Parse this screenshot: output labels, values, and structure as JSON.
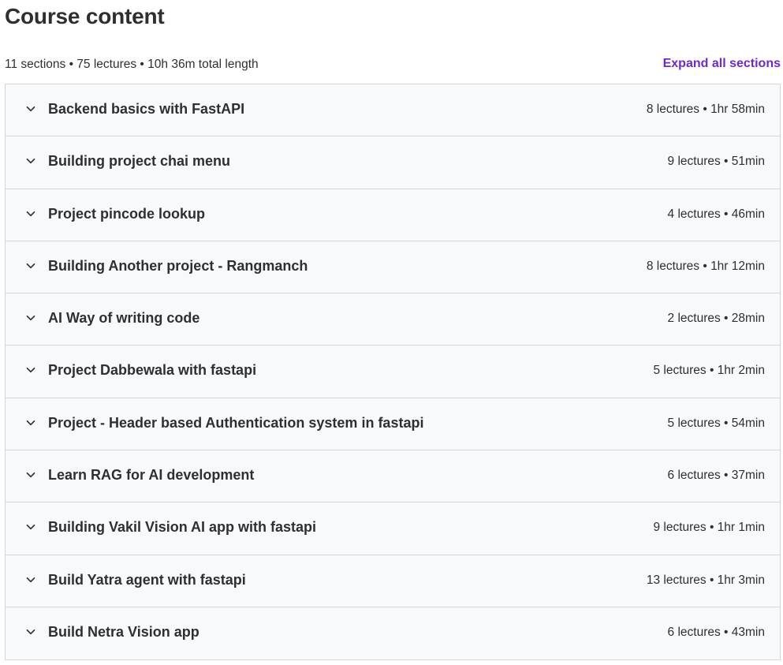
{
  "header": {
    "title": "Course content",
    "summary": "11 sections • 75 lectures • 10h 36m total length",
    "expand_all_label": "Expand all sections"
  },
  "sections": [
    {
      "title": "Backend basics with FastAPI",
      "meta": "8 lectures • 1hr 58min"
    },
    {
      "title": "Building project chai menu",
      "meta": "9 lectures • 51min"
    },
    {
      "title": "Project pincode lookup",
      "meta": "4 lectures • 46min"
    },
    {
      "title": "Building Another project - Rangmanch",
      "meta": "8 lectures • 1hr 12min"
    },
    {
      "title": "AI Way of writing code",
      "meta": "2 lectures • 28min"
    },
    {
      "title": "Project Dabbewala with fastapi",
      "meta": "5 lectures • 1hr 2min"
    },
    {
      "title": "Project - Header based Authentication system in fastapi",
      "meta": "5 lectures • 54min"
    },
    {
      "title": "Learn RAG for AI development",
      "meta": "6 lectures • 37min"
    },
    {
      "title": "Building Vakil Vision AI app with fastapi",
      "meta": "9 lectures • 1hr 1min"
    },
    {
      "title": "Build Yatra agent with fastapi",
      "meta": "13 lectures • 1hr 3min"
    },
    {
      "title": "Build Netra Vision app",
      "meta": "6 lectures • 43min"
    }
  ],
  "icons": {
    "section_toggle": "chevron-down-icon"
  },
  "colors": {
    "accent": "#6d28d2",
    "text": "#2d2f31",
    "section_bg": "#f7f9fa",
    "border": "#d1d7dc"
  }
}
